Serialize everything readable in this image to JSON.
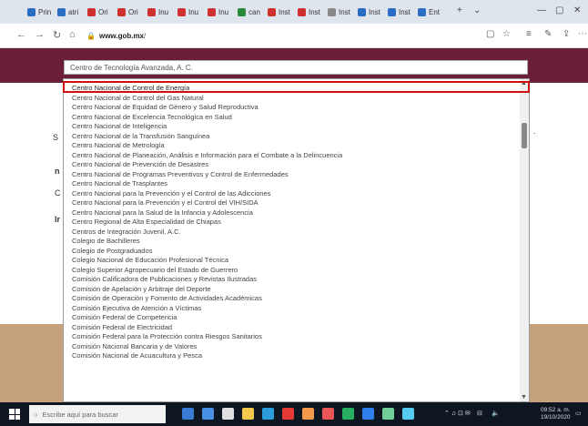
{
  "browser": {
    "tabs": [
      {
        "label": "Prin",
        "color": "#2b6cc4"
      },
      {
        "label": "atri",
        "color": "#2b6cc4"
      },
      {
        "label": "Ori",
        "color": "#d03030"
      },
      {
        "label": "Ori",
        "color": "#d03030"
      },
      {
        "label": "Inu",
        "color": "#d03030"
      },
      {
        "label": "Inu",
        "color": "#d03030"
      },
      {
        "label": "Inu",
        "color": "#d03030"
      },
      {
        "label": "can",
        "color": "#2a8a3a"
      },
      {
        "label": "Inst",
        "color": "#d03030"
      },
      {
        "label": "Inst",
        "color": "#d03030"
      },
      {
        "label": "Inst",
        "color": "#888888"
      },
      {
        "label": "Inst",
        "color": "#2b6cc4"
      },
      {
        "label": "Inst",
        "color": "#2b6cc4"
      },
      {
        "label": "Ent",
        "color": "#2b6cc4"
      }
    ],
    "url_host": "www.gob.mx",
    "url_path": "/"
  },
  "dropdown": {
    "selected": "Centro de Tecnología Avanzada, A. C.",
    "options": [
      "Centro Nacional de Control de Energía",
      "Centro Nacional de Control del Gas Natural",
      "Centro Nacional de Equidad de Género y Salud Reproductiva",
      "Centro Nacional de Excelencia Tecnológica en Salud",
      "Centro Nacional de Inteligencia",
      "Centro Nacional de la Transfusión Sanguínea",
      "Centro Nacional de Metrología",
      "Centro Nacional de Planeación, Análisis e Información para el Combate a la Delincuencia",
      "Centro Nacional de Prevención de Desastres",
      "Centro Nacional de Programas Preventivos y Control de Enfermedades",
      "Centro Nacional de Trasplantes",
      "Centro Nacional para la Prevención y el Control de las Adicciones",
      "Centro Nacional para la Prevención y el Control del VIH/SIDA",
      "Centro Nacional para la Salud de la Infancia y Adolescencia",
      "Centro Regional de Alta Especialidad de Chiapas",
      "Centros de Integración Juvenil, A.C.",
      "Colegio de Bachilleres",
      "Colegio de Postgraduados",
      "Colegio Nacional de Educación Profesional Técnica",
      "Colegio Superior Agropecuario del Estado de Guerrero",
      "Comisión Calificadora de Publicaciones y Revistas Ilustradas",
      "Comisión de Apelación y Arbitraje del Deporte",
      "Comisión de Operación y Fomento de Actividades Académicas",
      "Comisión Ejecutiva de Atención a Víctimas",
      "Comisión Federal de Competencia",
      "Comisión Federal de Electricidad",
      "Comisión Federal para la Protección contra Riesgos Sanitarios",
      "Comisión Nacional Bancaria y de Valores",
      "Comisión Nacional de Acuacultura y Pesca"
    ]
  },
  "taskbar": {
    "search_placeholder": "Escribe aquí para buscar",
    "apps": [
      "#3a7bd5",
      "#4a90e2",
      "#e0e0e0",
      "#f2c94c",
      "#2d9cdb",
      "#e53935",
      "#f2994a",
      "#eb5757",
      "#27ae60",
      "#2f80ed",
      "#6fcf97",
      "#56ccf2"
    ],
    "clock_time": "09:52 a. m.",
    "clock_date": "19/10/2020"
  }
}
